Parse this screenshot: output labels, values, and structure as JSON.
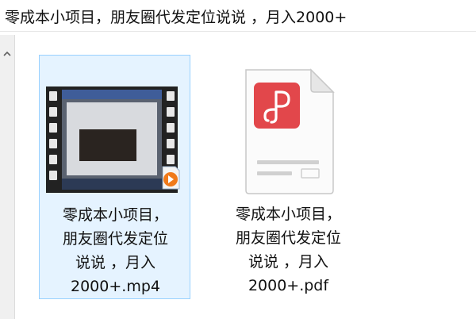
{
  "window": {
    "title": "零成本小项目，朋友圈代发定位说说 ，月入2000+"
  },
  "files": [
    {
      "name": "零成本小项目，\n朋友圈代发定位\n说说 ，月入\n2000+.mp4",
      "type": "video",
      "selected": true,
      "icon": "video-thumbnail-icon"
    },
    {
      "name": "零成本小项目，\n朋友圈代发定位\n说说 ，月入\n2000+.pdf",
      "type": "pdf",
      "selected": false,
      "icon": "pdf-file-icon"
    }
  ],
  "colors": {
    "selection_bg": "#e5f3ff",
    "selection_border": "#99d1ff",
    "pdf_red": "#e2474b",
    "play_orange": "#f07a1a"
  }
}
